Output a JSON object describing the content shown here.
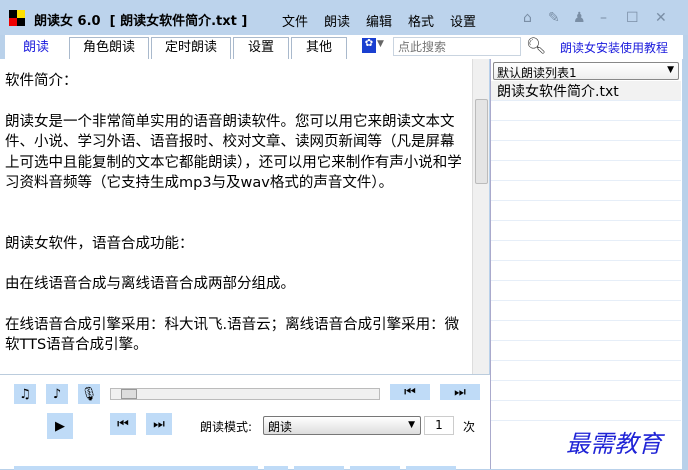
{
  "titlebar": {
    "title": "朗读女 6.0  [ 朗读女软件简介.txt ]",
    "menus": [
      "文件",
      "朗读",
      "编辑",
      "格式",
      "设置"
    ]
  },
  "tabs": [
    "朗读",
    "角色朗读",
    "定时朗读",
    "设置",
    "其他"
  ],
  "search": {
    "placeholder": "点此搜索"
  },
  "tutorial_link": "朗读女安装使用教程",
  "content": [
    "软件简介：",
    "朗读女是一个非常简单实用的语音朗读软件。您可以用它来朗读文本文件、小说、学习外语、语音报时、校对文章、读网页新闻等（凡是屏幕上可选中且能复制的文本它都能朗读），还可以用它来制作有声小说和学习资料音频等（它支持生成mp3与及wav格式的声音文件）。",
    "朗读女软件，语音合成功能：",
    "由在线语音合成与离线语音合成两部分组成。",
    "在线语音合成引擎采用：科大讯飞.语音云；离线语音合成引擎采用：微软TTS语音合成引擎。"
  ],
  "playlist": {
    "selected": "默认朗读列表1",
    "items": [
      "朗读女软件简介.txt"
    ]
  },
  "controls": {
    "mode_label": "朗读模式:",
    "mode_value": "朗读",
    "repeat": "1",
    "repeat_unit": "次"
  },
  "watermark": "最需教育"
}
